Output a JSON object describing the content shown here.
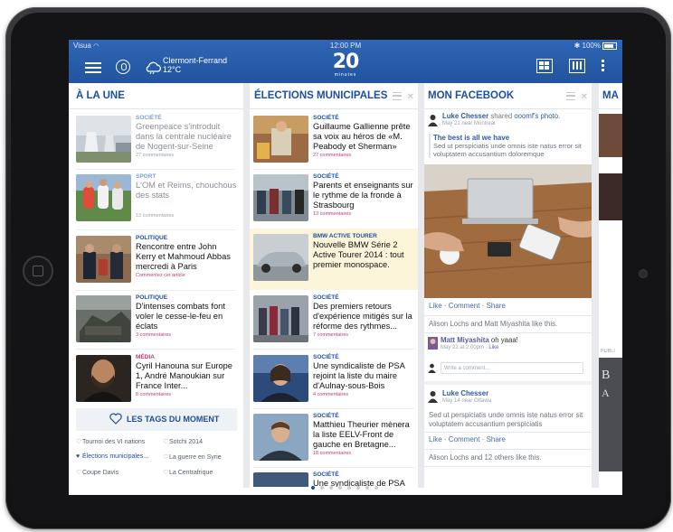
{
  "status_bar": {
    "carrier": "Visua",
    "time": "12:00 PM",
    "battery": "100%"
  },
  "header": {
    "city": "Clermont-Ferrand",
    "temperature": "12°C",
    "logo_number": "20",
    "logo_sub": "minutes"
  },
  "columns": [
    {
      "title": "À LA UNE",
      "articles": [
        {
          "category": "SOCIÉTÉ",
          "title": "Greenpeace s'introduit dans la centrale nucléaire de Nogent-sur-Seine",
          "comments": "27 commentaires",
          "read": true
        },
        {
          "category": "SPORT",
          "title": "L'OM et Reims, chouchous des stats",
          "comments": "13 commentaires",
          "read": true
        },
        {
          "category": "POLITIQUE",
          "title": "Rencontre entre John Kerry et Mahmoud Abbas mercredi à Paris",
          "comments": "Commentez cet article",
          "read": false
        },
        {
          "category": "POLITIQUE",
          "title": "D'intenses combats font voler le cesse-le-feu en éclats",
          "comments": "3 commentaires",
          "read": false
        },
        {
          "category": "MÉDIA",
          "title": "Cyril Hanouna sur Europe 1, André Manoukian sur France Inter...",
          "comments": "8 commentaires",
          "read": false
        }
      ],
      "tags_title": "LES TAGS DU MOMENT",
      "tags": [
        "Tournoi des VI nations",
        "Sotchi 2014",
        "Élections municipales...",
        "La guerre en Syrie",
        "Coupe Davis",
        "La Centrafrique"
      ]
    },
    {
      "title": "ÉLECTIONS MUNICIPALES",
      "articles": [
        {
          "category": "SOCIÉTÉ",
          "title": "Guillaume Gallienne prête sa voix au héros de «M. Peabody et Sherman»",
          "comments": "27 commentaires"
        },
        {
          "category": "SOCIÉTÉ",
          "title": "Parents et enseignants sur le rythme de la fronde à Strasbourg",
          "comments": "13 commentaires"
        },
        {
          "category": "BMW ACTIVE TOURER",
          "title": "Nouvelle BMW Série 2 Active Tourer 2014 : tout premier monospace.",
          "comments": ""
        },
        {
          "category": "SOCIÉTÉ",
          "title": "Des premiers retours d'expérience mitigés sur la réforme des rythmes...",
          "comments": "7 commentaires"
        },
        {
          "category": "SOCIÉTÉ",
          "title": "Une syndicaliste de PSA rejoint la liste du maire d'Aulnay-sous-Bois",
          "comments": "4 commentaires"
        },
        {
          "category": "SOCIÉTÉ",
          "title": "Matthieu Theurier mènera la liste EELV-Front de gauche en Bretagne...",
          "comments": "18 commentaires"
        },
        {
          "category": "SOCIÉTÉ",
          "title": "Une syndicaliste de PSA",
          "comments": ""
        }
      ]
    },
    {
      "title": "MON FACEBOOK",
      "post1": {
        "author": "Luke Chesser",
        "action": "shared",
        "object": "ooomf's photo.",
        "meta": "May 21 near Montreal",
        "link_title": "The best is all we have",
        "link_desc": "Sed ut perspiciatis unde omnis iste natus error sit voluptatem accusantium doloremque",
        "actions": "Like · Comment · Share",
        "likes": "Alison Lochs and Matt Miyashita like this.",
        "comment_author": "Matt Miyashita",
        "comment_text": "oh yaaa!",
        "comment_meta": "May 22 at 2:00pm · ",
        "comment_like": "Like",
        "write_placeholder": "Write a comment..."
      },
      "post2": {
        "author": "Luke Chesser",
        "meta": "May 14 near Ottawa",
        "text": "Sed ut perspiciatis unde omnis iste natus error sit voluptatem accusantium perspiciatis",
        "actions": "Like · Comment · Share",
        "likes": "Alison Lochs and 12 others like this."
      }
    },
    {
      "title": "MA",
      "label": "PUBLI"
    }
  ],
  "pagination": {
    "total": 8,
    "current": 1
  },
  "colors": {
    "brand_blue": "#22549f",
    "title_blue": "#1c4f9c",
    "comment_pink": "#c0397c",
    "sponsored_bg": "#fdf5da"
  },
  "icons": [
    "menu-icon",
    "user-icon",
    "weather-icon",
    "grid-view-icon",
    "column-view-icon",
    "more-icon",
    "heart-icon",
    "drag-handle-icon",
    "close-icon"
  ]
}
